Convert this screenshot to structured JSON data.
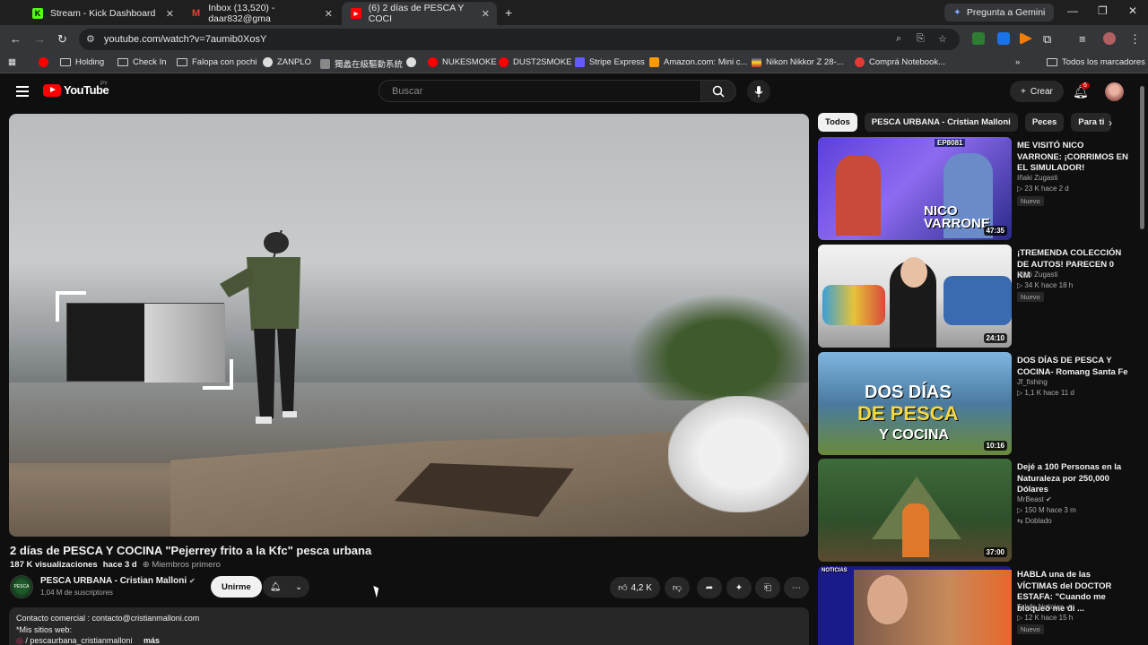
{
  "browser": {
    "tabs": [
      {
        "label": "Stream - Kick Dashboard",
        "icon": "kick-icon"
      },
      {
        "label": "Inbox (13,520) - daar832@gma",
        "icon": "gmail-icon"
      },
      {
        "label": "(6) 2 días de PESCA Y COCI",
        "icon": "youtube-icon"
      }
    ],
    "gemini_label": "Pregunta a Gemini",
    "url": "youtube.com/watch?v=7aumib0XosY",
    "bookmarks": [
      "Holding",
      "Check In",
      "Falopa con pochi",
      "ZANPLO",
      "獨蠡在級驅動系統",
      "NUKESMOKE",
      "DUST2SMOKE",
      "Stripe Express",
      "Amazon.com: Mini c...",
      "Nikon Nikkor Z 28-...",
      "Comprá Notebook..."
    ],
    "all_bookmarks": "Todos los marcadores"
  },
  "youtube": {
    "logo_text": "YouTube",
    "country": "PY",
    "search_placeholder": "Buscar",
    "create_label": "Crear",
    "notif_count": "6"
  },
  "video": {
    "title": "2 días de PESCA Y COCINA \"Pejerrey frito a la Kfc\" pesca urbana",
    "views": "187 K visualizaciones",
    "age": "hace 3 d",
    "members": "Miembros primero",
    "channel": "PESCA URBANA - Cristian Malloni",
    "subs": "1,04 M de suscriptores",
    "join_label": "Unirme",
    "likes": "4,2 K",
    "desc_line1": "Contacto comercial : contacto@cristianmalloni.com",
    "desc_line2": "*Mis sitios web:",
    "desc_line3": "/ pescaurbana_cristianmalloni",
    "more_label": "más"
  },
  "chips": [
    "Todos",
    "PESCA URBANA - Cristian Malloni",
    "Peces",
    "Para ti"
  ],
  "recommendations": [
    {
      "title": "ME VISITÓ NICO VARRONE: ¡CORRIMOS EN EL SIMULADOR!",
      "channel": "Iñaki Zugasti",
      "stats": "23 K  hace 2 d",
      "badge": "Nuevo",
      "duration": "47:35",
      "thumb_text": "NICO VARRONE",
      "thumb_tag": "EP8081"
    },
    {
      "title": "¡TREMENDA COLECCIÓN DE AUTOS! PARECEN 0 KM",
      "channel": "Iñaki Zugasti",
      "stats": "34 K  hace 18 h",
      "badge": "Nuevo",
      "duration": "24:10"
    },
    {
      "title": "DOS DÍAS DE PESCA Y COCINA- Romang Santa Fe",
      "channel": "Jf_fishing",
      "stats": "1,1 K  hace 11 d",
      "duration": "10:16",
      "thumb_text1": "DOS DÍAS",
      "thumb_text2": "DE PESCA",
      "thumb_text3": "Y COCINA"
    },
    {
      "title": "Dejé a 100 Personas en la Naturaleza por 250,000 Dólares",
      "channel": "MrBeast",
      "stats": "150 M  hace 3 m",
      "badge": "Doblado",
      "duration": "37:00"
    },
    {
      "title": "HABLA una de las VÍCTIMAS del DOCTOR ESTAFA: \"Cuando me bloqueó me di ...",
      "channel": "Telefe Noticias",
      "stats": "12 K  hace 15 h",
      "badge": "Nuevo",
      "thumb_tag": "NOTICIAS"
    }
  ]
}
